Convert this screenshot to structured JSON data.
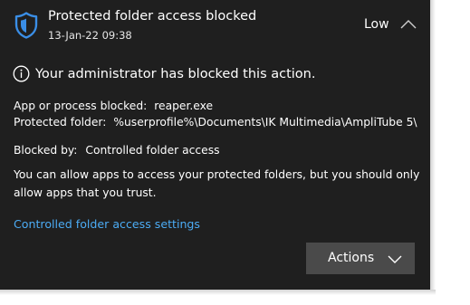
{
  "colors": {
    "card_background": "#1f1f1f",
    "accent_blue": "#4cacf5",
    "shield_blue": "#3a8ee6",
    "button_background": "#4a4a4a",
    "text": "#ffffff"
  },
  "notification": {
    "title": "Protected folder access blocked",
    "timestamp": "13-Jan-22 09:38",
    "severity": "Low",
    "app_icon": "shield-icon",
    "collapse_icon": "chevron-up-icon"
  },
  "message": {
    "icon": "info-icon",
    "text": "Your administrator has blocked this action."
  },
  "details": {
    "app_label": "App or process blocked:",
    "app_value": "reaper.exe",
    "folder_label": "Protected folder:",
    "folder_value": "%userprofile%\\Documents\\IK Multimedia\\AmpliTube 5\\",
    "blocked_by_label": "Blocked by:",
    "blocked_by_value": "Controlled folder access"
  },
  "paragraph": "You can allow apps to access your protected folders, but you should only allow apps that you trust.",
  "link": "Controlled folder access settings",
  "actions": {
    "label": "Actions",
    "icon": "chevron-down-icon"
  }
}
